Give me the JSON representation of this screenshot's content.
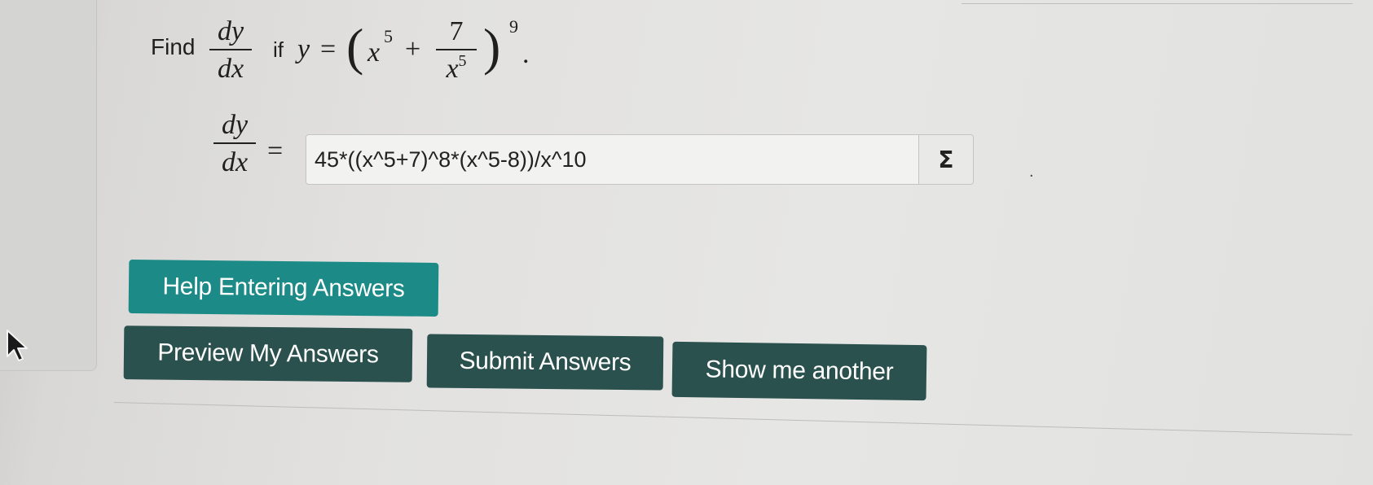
{
  "question": {
    "find_label": "Find",
    "if_label": "if",
    "derivative_numerator": "dy",
    "derivative_denominator": "dx",
    "y_var": "y",
    "equals": "=",
    "open_paren": "(",
    "close_paren": ")",
    "x_base": "x",
    "x_exponent": "5",
    "plus": "+",
    "fraction_numerator": "7",
    "fraction_denominator_base": "x",
    "fraction_denominator_exponent": "5",
    "outer_exponent": "9",
    "period": "."
  },
  "answer": {
    "lhs_numerator": "dy",
    "lhs_denominator": "dx",
    "equals": "=",
    "value": "45*((x^5+7)^8*(x^5-8))/x^10",
    "equation_editor_symbol": "Σ",
    "trailing_period": "."
  },
  "buttons": {
    "help": "Help Entering Answers",
    "preview": "Preview My Answers",
    "submit": "Submit Answers",
    "show_another": "Show me another"
  },
  "colors": {
    "help_button": "#1c8a86",
    "action_button": "#2a514d",
    "button_text": "#ffffff"
  },
  "icons": {
    "cursor": "mouse-pointer-icon",
    "sigma": "sigma-icon"
  }
}
